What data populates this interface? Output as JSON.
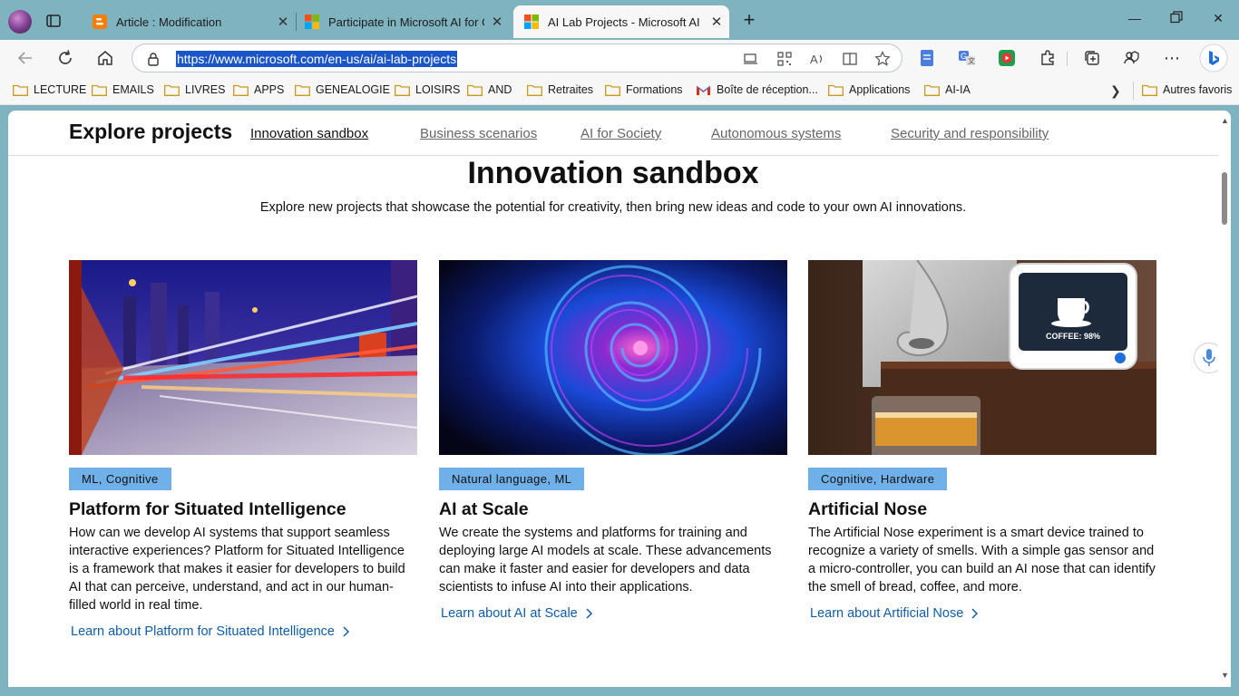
{
  "browser": {
    "tabs": [
      {
        "title": "Article : Modification",
        "favicon": "blogger-icon",
        "active": false
      },
      {
        "title": "Participate in Microsoft AI for Go",
        "favicon": "microsoft-icon",
        "active": false
      },
      {
        "title": "AI Lab Projects - Microsoft AI Lab",
        "favicon": "microsoft-icon",
        "active": true
      }
    ],
    "new_tab_label": "+",
    "address": "https://www.microsoft.com/en-us/ai/ai-lab-projects",
    "bookmarks": [
      "LECTURE",
      "EMAILS",
      "LIVRES",
      "APPS",
      "GENEALOGIE",
      "LOISIRS",
      "AND",
      "Retraites",
      "Formations",
      "Boîte de réception...",
      "Applications",
      "AI-IA"
    ],
    "other_bookmarks": "Autres favoris",
    "accent": "#7fb3c0"
  },
  "page": {
    "nav": {
      "heading": "Explore projects",
      "links": [
        "Innovation sandbox",
        "Business scenarios",
        "AI for Society",
        "Autonomous systems",
        "Security and responsibility"
      ]
    },
    "section": {
      "title": "Innovation sandbox",
      "description": "Explore new projects that showcase the potential for creativity, then bring new ideas and code to your own AI innovations."
    },
    "cards": [
      {
        "tag": "ML, Cognitive",
        "title": "Platform for Situated Intelligence",
        "description": "How can we develop AI systems that support seamless interactive experiences? Platform for Situated Intelligence is a framework that makes it easier for developers to build AI that can perceive, understand, and act in our human-filled world in real time.",
        "link": "Learn about Platform for Situated Intelligence"
      },
      {
        "tag": "Natural language, ML",
        "title": "AI at Scale",
        "description": "We create the systems and platforms for training and deploying large AI models at scale. These advancements can make it faster and easier for developers and data scientists to infuse AI into their applications.",
        "link": "Learn about AI at Scale"
      },
      {
        "tag": "Cognitive, Hardware",
        "title": "Artificial Nose",
        "description": "The Artificial Nose experiment is a smart device trained to recognize a variety of smells. With a simple gas sensor and a micro-controller, you can build an AI nose that can identify the smell of bread, coffee, and more.",
        "link": "Learn about Artificial Nose",
        "image_text": "COFFEE: 98%"
      }
    ],
    "tag_color": "#6fb0e8",
    "link_color": "#0f5cab"
  }
}
